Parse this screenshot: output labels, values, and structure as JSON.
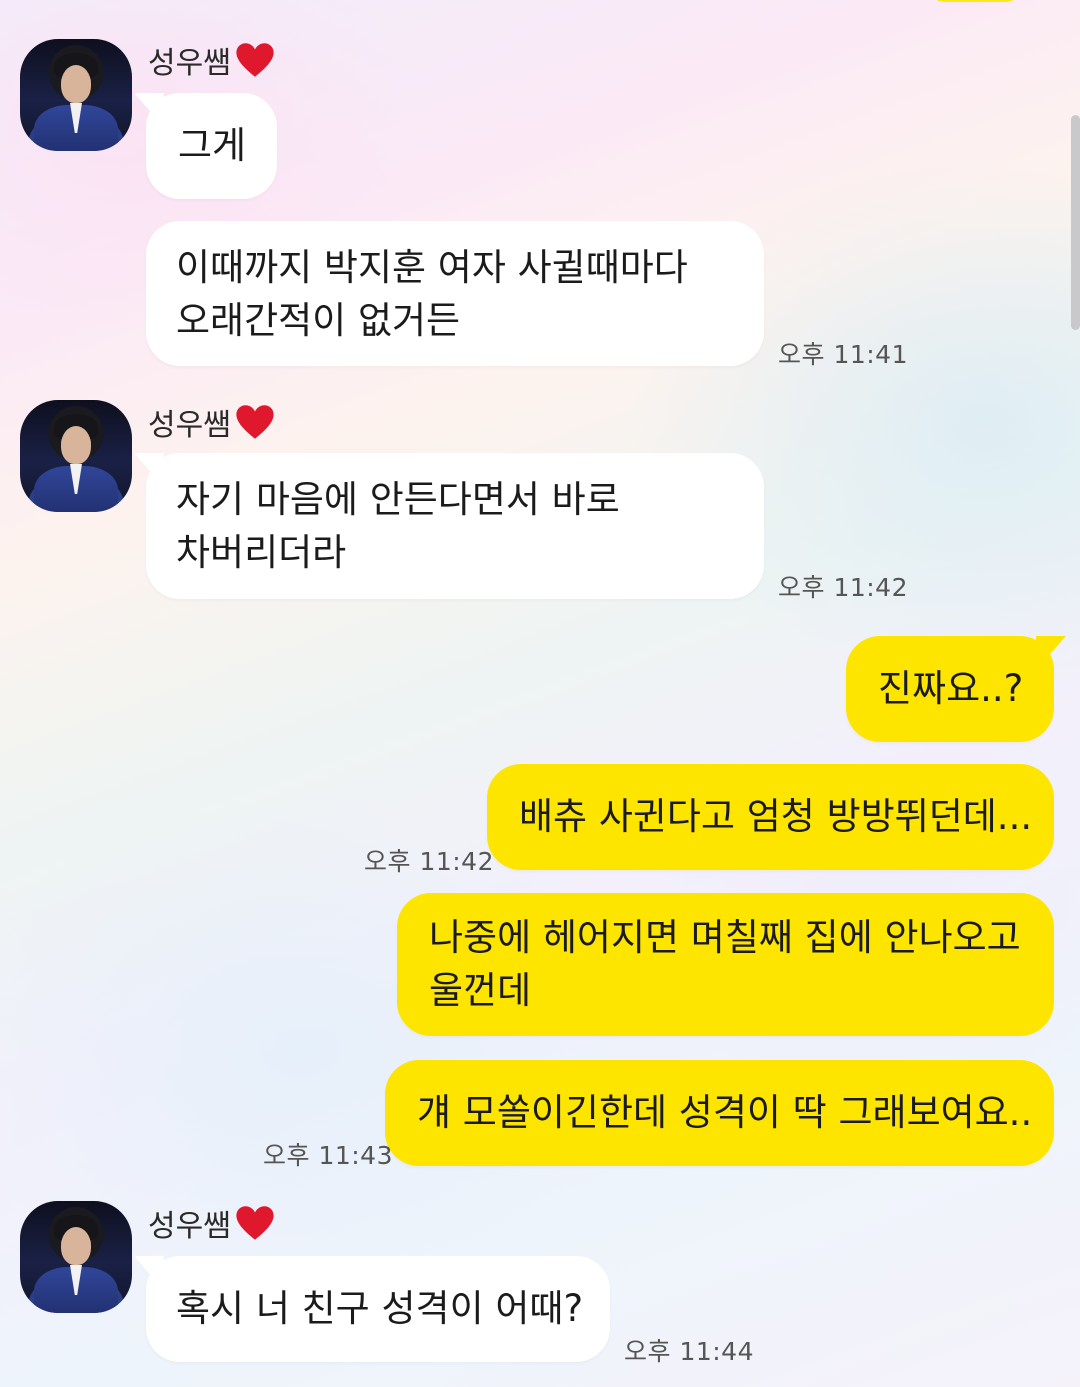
{
  "sender": {
    "name": "성우쌤",
    "heart": "❤"
  },
  "messages": {
    "m1": {
      "text": "그게"
    },
    "m2": {
      "text": "이때까지 박지훈 여자 사귈때마다\n오래간적이 없거든",
      "time": "오후 11:41"
    },
    "m3": {
      "text": "자기 마음에 안든다면서 바로\n차버리더라",
      "time": "오후 11:42"
    },
    "m4": {
      "text": "진짜요..?"
    },
    "m5": {
      "text": "배츄 사귄다고 엄청 방방뛰던데...",
      "time": "오후 11:42"
    },
    "m6": {
      "text": "나중에 헤어지면 며칠째 집에 안나오고\n울껀데"
    },
    "m7": {
      "text": "걔 모쏠이긴한데 성격이 딱 그래보여요..",
      "time": "오후 11:43"
    },
    "m8": {
      "text": "혹시 너 친구 성격이 어때?",
      "time": "오후 11:44"
    }
  },
  "colors": {
    "incoming_bubble": "#ffffff",
    "outgoing_bubble": "#fee500",
    "heart": "#e0182d"
  }
}
